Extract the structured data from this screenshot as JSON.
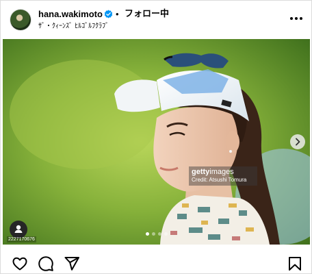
{
  "header": {
    "username": "hana.wakimoto",
    "separator": "•",
    "follow_label": "フォロー中",
    "location": "ｻﾞ・ｸｨｰﾝｽﾞ ﾋﾙｺﾞﾙﾌｸﾗﾌﾞ",
    "verified": true,
    "more_icon": "more-horizontal-icon"
  },
  "media": {
    "watermark_logo_bold": "getty",
    "watermark_logo_light": "images",
    "watermark_credit": "Credit: Atsushi Tomura",
    "image_id": "2227170676",
    "carousel": {
      "total": 4,
      "active_index": 0
    },
    "icons": {
      "next": "chevron-right-icon",
      "tag": "user-tag-icon"
    }
  },
  "actions": {
    "icons": [
      "heart-icon",
      "comment-icon",
      "share-icon",
      "bookmark-icon"
    ]
  },
  "colors": {
    "verified": "#0095f6",
    "text": "#000000",
    "border": "#dbdbdb"
  }
}
